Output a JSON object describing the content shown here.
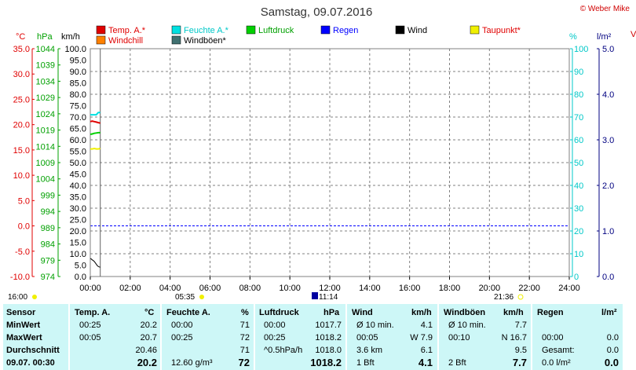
{
  "header": {
    "title": "Samstag, 09.07.2016",
    "copyright": "© Weber Mike",
    "right_cut_label": "V"
  },
  "colors": {
    "temp": "#e00000",
    "humidity": "#00e0e0",
    "pressure": "#00d000",
    "rain": "#0000ff",
    "wind": "#000000",
    "dewpoint": "#f0f000",
    "windchill": "#ff8000",
    "gust": "#407070",
    "stats_bg": "#cdf7f7",
    "dash": "#808080",
    "zero_line": "#0000ff"
  },
  "legend": {
    "row1": [
      "Temp. A.*",
      "Feuchte A.*",
      "Luftdruck",
      "Regen",
      "Wind",
      "Taupunkt*"
    ],
    "row2": [
      "Windchill",
      "Windböen*"
    ]
  },
  "axes_units": {
    "temp": "°C",
    "pressure": "hPa",
    "wind": "km/h",
    "humidity": "%",
    "rain": "l/m²"
  },
  "sun_events": {
    "midnight": "16:00",
    "sunrise": "05:35",
    "noon": "11:14",
    "sunset": "21:36"
  },
  "chart_data": {
    "type": "line",
    "x_ticks": [
      "00:00",
      "02:00",
      "04:00",
      "06:00",
      "08:00",
      "10:00",
      "12:00",
      "14:00",
      "16:00",
      "18:00",
      "20:00",
      "22:00",
      "24:00"
    ],
    "xlim_hours": [
      0,
      24
    ],
    "current_time_hours": 0.5,
    "grid": true,
    "axes": {
      "temp": {
        "unit": "°C",
        "range": [
          -10,
          35
        ],
        "ticks": [
          "35.0",
          "30.0",
          "25.0",
          "20.0",
          "15.0",
          "10.0",
          "5.0",
          "0.0",
          "-5.0",
          "-10.0"
        ]
      },
      "pressure": {
        "unit": "hPa",
        "range": [
          974,
          1044
        ],
        "ticks": [
          "1044",
          "1039",
          "1034",
          "1029",
          "1024",
          "1019",
          "1014",
          "1009",
          "1004",
          "999",
          "994",
          "989",
          "984",
          "979",
          "974"
        ]
      },
      "wind": {
        "unit": "km/h",
        "range": [
          0,
          100
        ],
        "ticks": [
          "100.0",
          "95.0",
          "90.0",
          "85.0",
          "80.0",
          "75.0",
          "70.0",
          "65.0",
          "60.0",
          "55.0",
          "50.0",
          "45.0",
          "40.0",
          "35.0",
          "30.0",
          "25.0",
          "20.0",
          "15.0",
          "10.0",
          "5.0",
          "0.0"
        ]
      },
      "humidity": {
        "unit": "%",
        "range": [
          0,
          100
        ],
        "ticks": [
          "100",
          "90",
          "80",
          "70",
          "60",
          "50",
          "40",
          "30",
          "20",
          "10",
          "0"
        ]
      },
      "rain": {
        "unit": "l/m²",
        "range": [
          0,
          5
        ],
        "ticks": [
          "5.0",
          "4.0",
          "3.0",
          "2.0",
          "1.0",
          "0.0"
        ]
      }
    },
    "series": [
      {
        "name": "Temp. A.*",
        "axis": "temp",
        "x": [
          0,
          0.1,
          0.2,
          0.3,
          0.4,
          0.5
        ],
        "y": [
          20.6,
          20.7,
          20.6,
          20.5,
          20.4,
          20.3
        ]
      },
      {
        "name": "Feuchte A.*",
        "axis": "humidity",
        "x": [
          0,
          0.1,
          0.2,
          0.3,
          0.4,
          0.5
        ],
        "y": [
          71,
          71,
          71,
          71,
          72,
          72
        ]
      },
      {
        "name": "Luftdruck",
        "axis": "pressure",
        "x": [
          0,
          0.1,
          0.2,
          0.3,
          0.4,
          0.5
        ],
        "y": [
          1017.7,
          1017.8,
          1018.0,
          1018.1,
          1018.2,
          1018.2
        ]
      },
      {
        "name": "Taupunkt*",
        "axis": "temp",
        "x": [
          0,
          0.1,
          0.2,
          0.3,
          0.4,
          0.5
        ],
        "y": [
          15.2,
          15.2,
          15.3,
          15.2,
          15.2,
          15.3
        ]
      },
      {
        "name": "Wind",
        "axis": "wind",
        "x": [
          0,
          0.05,
          0.1,
          0.15,
          0.2,
          0.25,
          0.3,
          0.35,
          0.4,
          0.45,
          0.5
        ],
        "y": [
          7.9,
          7.7,
          7.3,
          7.0,
          6.6,
          6.0,
          5.4,
          4.8,
          4.4,
          4.2,
          4.1
        ]
      }
    ]
  },
  "stats": {
    "headers": {
      "sensor": "Sensor",
      "temp": "Temp. A.",
      "temp_unit": "°C",
      "hum": "Feuchte A.",
      "hum_unit": "%",
      "press": "Luftdruck",
      "press_unit": "hPa",
      "wind": "Wind",
      "wind_unit": "km/h",
      "gust": "Windböen",
      "gust_unit": "km/h",
      "rain": "Regen",
      "rain_unit": "l/m²"
    },
    "rows": [
      {
        "label": "MinWert",
        "t_time": "00:25",
        "t_val": "20.2",
        "h_time": "00:00",
        "h_val": "71",
        "p_time": "00:00",
        "p_val": "1017.7",
        "w_time": "Ø 10 min.",
        "w_val": "4.1",
        "g_time": "Ø 10 min.",
        "g_val": "7.7",
        "r_time": "",
        "r_val": ""
      },
      {
        "label": "MaxWert",
        "t_time": "00:05",
        "t_val": "20.7",
        "h_time": "00:25",
        "h_val": "72",
        "p_time": "00:25",
        "p_val": "1018.2",
        "w_time": "00:05",
        "w_val": "W 7.9",
        "g_time": "00:10",
        "g_val": "N 16.7",
        "r_time": "00:00",
        "r_val": "0.0"
      },
      {
        "label": "Durchschnitt",
        "t_time": "",
        "t_val": "20.46",
        "h_time": "",
        "h_val": "71",
        "p_time": "^0.5hPa/h",
        "p_val": "1018.0",
        "w_time": "3.6 km",
        "w_val": "6.1",
        "g_time": "",
        "g_val": "9.5",
        "r_time": "Gesamt:",
        "r_val": "0.0"
      },
      {
        "label": "09.07. 00:30",
        "t_time": "",
        "t_val": "20.2",
        "h_time": "12.60 g/m³",
        "h_val": "72",
        "p_time": "",
        "p_val": "1018.2",
        "w_time": "1 Bft",
        "w_val": "4.1",
        "g_time": "2 Bft",
        "g_val": "7.7",
        "r_time": "0.0 l/m²",
        "r_val": "0.0"
      }
    ]
  }
}
